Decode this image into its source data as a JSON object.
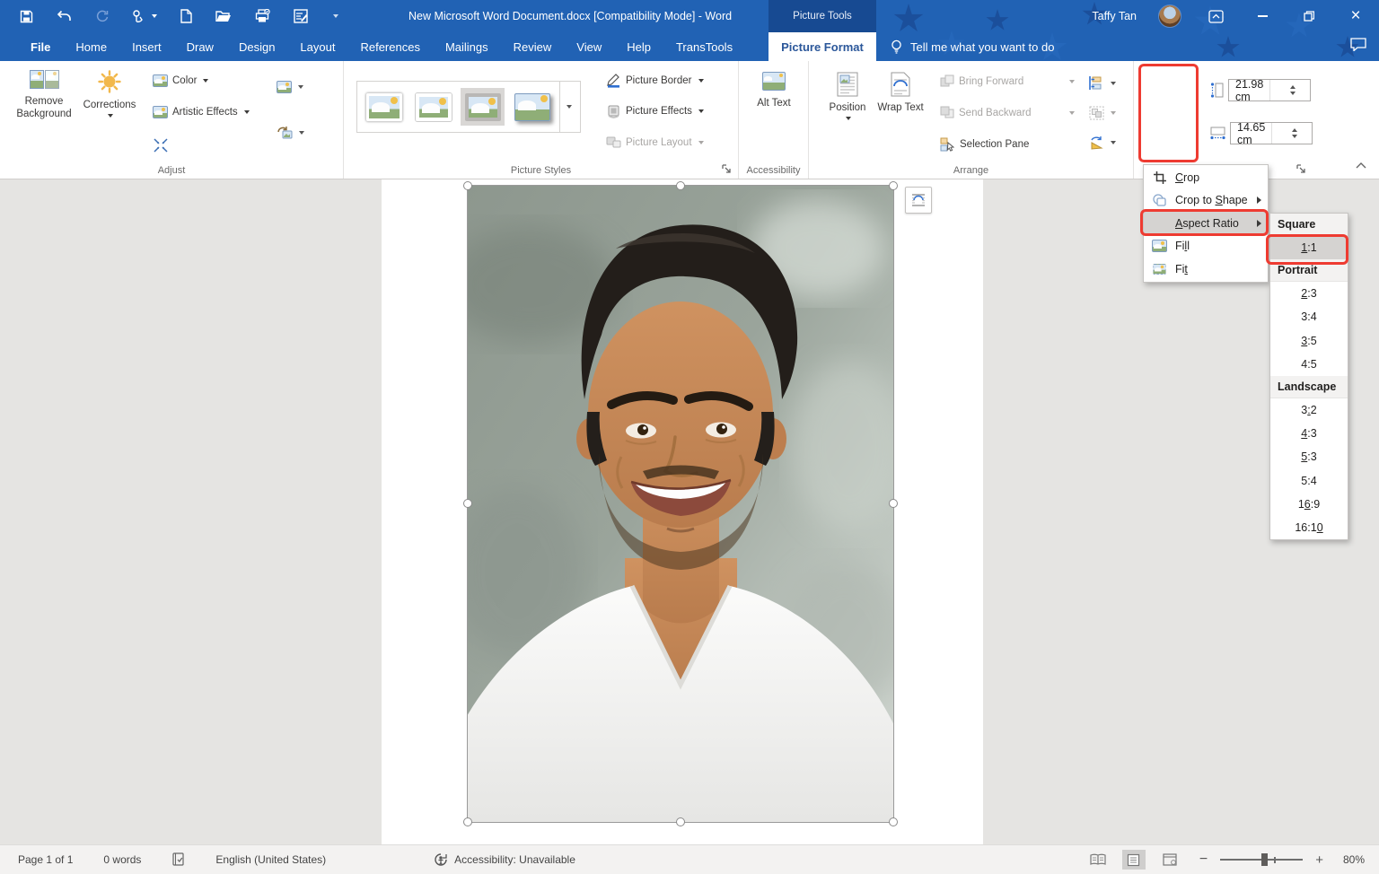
{
  "colors": {
    "titlebar_blue": "#2162b4",
    "annotation_red": "#ee3b31",
    "accent_blue": "#2b579a",
    "menu_highlight": "#d5d3d1"
  },
  "titlebar": {
    "title": "New Microsoft Word Document.docx [Compatibility Mode] - Word",
    "context_tab_group": "Picture Tools",
    "user": "Taffy Tan",
    "qat_icons": [
      "save-icon",
      "undo-icon",
      "redo-icon",
      "touch-mode-icon",
      "new-document-icon",
      "open-icon",
      "quick-print-icon",
      "print-preview-icon",
      "customize-qat-icon"
    ]
  },
  "tabs": {
    "items": [
      "File",
      "Home",
      "Insert",
      "Draw",
      "Design",
      "Layout",
      "References",
      "Mailings",
      "Review",
      "View",
      "Help",
      "TransTools"
    ],
    "active": "Picture Format",
    "tell_me": "Tell me what you want to do"
  },
  "ribbon": {
    "adjust": {
      "label": "Adjust",
      "remove_background": "Remove Background",
      "corrections": "Corrections",
      "color": "Color",
      "artistic_effects": "Artistic Effects"
    },
    "picture_styles": {
      "label": "Picture Styles",
      "picture_border": "Picture Border",
      "picture_effects": "Picture Effects",
      "picture_layout": "Picture Layout"
    },
    "accessibility": {
      "label": "Accessibility",
      "alt_text": "Alt Text"
    },
    "arrange": {
      "label": "Arrange",
      "position": "Position",
      "wrap_text": "Wrap Text",
      "bring_forward": "Bring Forward",
      "send_backward": "Send Backward",
      "selection_pane": "Selection Pane"
    },
    "size": {
      "crop": "Crop",
      "height_value": "21.98 cm",
      "width_value": "14.65 cm"
    }
  },
  "crop_menu": {
    "items": [
      {
        "label": {
          "text": "Crop",
          "u": 0
        },
        "icon": "crop-icon"
      },
      {
        "label": {
          "text": "Crop to Shape",
          "u": 8
        },
        "icon": "crop-to-shape-icon",
        "submenu": true
      },
      {
        "label": {
          "text": "Aspect Ratio",
          "u": 0
        },
        "submenu": true,
        "highlighted": true
      },
      {
        "label": {
          "text": "Fill",
          "u": 2
        },
        "icon": "fill-icon"
      },
      {
        "label": {
          "text": "Fit",
          "u": 2
        },
        "icon": "fit-icon"
      }
    ],
    "aspect_submenu": {
      "sections": [
        {
          "header": "Square",
          "items": [
            {
              "text": "1:1",
              "u": 0,
              "highlighted": true
            }
          ]
        },
        {
          "header": "Portrait",
          "items": [
            {
              "text": "2:3",
              "u": 0
            },
            {
              "text": "3:4",
              "u": null
            },
            {
              "text": "3:5",
              "u": 0
            },
            {
              "text": "4:5",
              "u": null
            }
          ]
        },
        {
          "header": "Landscape",
          "items": [
            {
              "text": "3:2",
              "u": 1
            },
            {
              "text": "4:3",
              "u": 0
            },
            {
              "text": "5:3",
              "u": 0
            },
            {
              "text": "5:4",
              "u": null
            },
            {
              "text": "16:9",
              "u": 1
            },
            {
              "text": "16:10",
              "u": 4
            }
          ]
        }
      ]
    }
  },
  "statusbar": {
    "page": "Page 1 of 1",
    "words": "0 words",
    "language": "English (United States)",
    "accessibility": "Accessibility: Unavailable",
    "zoom": "80%"
  }
}
